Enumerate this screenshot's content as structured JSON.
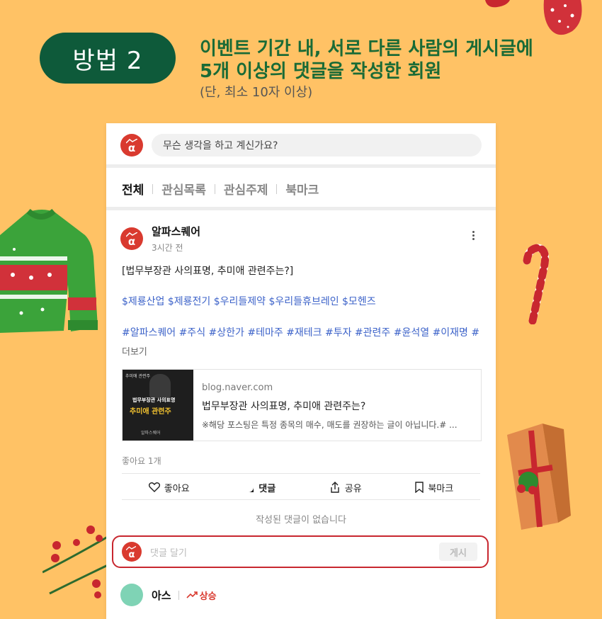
{
  "header": {
    "method_label": "방법 2",
    "condition_line1": "이벤트 기간 내, 서로 다른 사람의 게시글에",
    "condition_line2": "5개 이상의 댓글을 작성한 회원",
    "condition_note": "(단, 최소 10자 이상)"
  },
  "feed": {
    "compose_placeholder": "무슨 생각을 하고 계신가요?",
    "tabs": [
      {
        "label": "전체",
        "active": true
      },
      {
        "label": "관심목록",
        "active": false
      },
      {
        "label": "관심주제",
        "active": false
      },
      {
        "label": "북마크",
        "active": false
      }
    ],
    "post": {
      "author": "알파스퀘어",
      "time": "3시간 전",
      "title": "[법무부장관 사의표명, 추미애 관련주는?]",
      "tickers": "$제룡산업 $제룡전기 $우리들제약 $우리들휴브레인 $모헨즈",
      "hashtags": "#알파스퀘어 #주식 #상한가 #테마주 #재테크 #투자 #관련주 #윤석열 #이재명 #",
      "more": "더보기",
      "link": {
        "thumb_tag": "추미애 관련주",
        "thumb_line1": "법무부장관 사의표명",
        "thumb_line2": "추미애 관련주",
        "thumb_footer": "알파스퀘어",
        "domain": "blog.naver.com",
        "title": "법무부장관 사의표명, 추미애 관련주는?",
        "desc": "※해당 포스팅은 특정 종목의 매수, 매도를 권장하는 글이 아닙니다.# ..."
      },
      "likes": "좋아요 1개",
      "actions": {
        "like": "좋아요",
        "comment": "댓글",
        "share": "공유",
        "bookmark": "북마크"
      },
      "no_comments": "작성된 댓글이 없습니다",
      "comment_placeholder": "댓글 달기",
      "post_button": "게시"
    },
    "next_post": {
      "author": "아스",
      "trend": "상승"
    }
  },
  "colors": {
    "background": "#FFC265",
    "pill": "#0E5A3A",
    "heading": "#1A6B36",
    "brand_red": "#D93A2F",
    "highlight_border": "#C8272F",
    "link_blue": "#3D63C9"
  }
}
